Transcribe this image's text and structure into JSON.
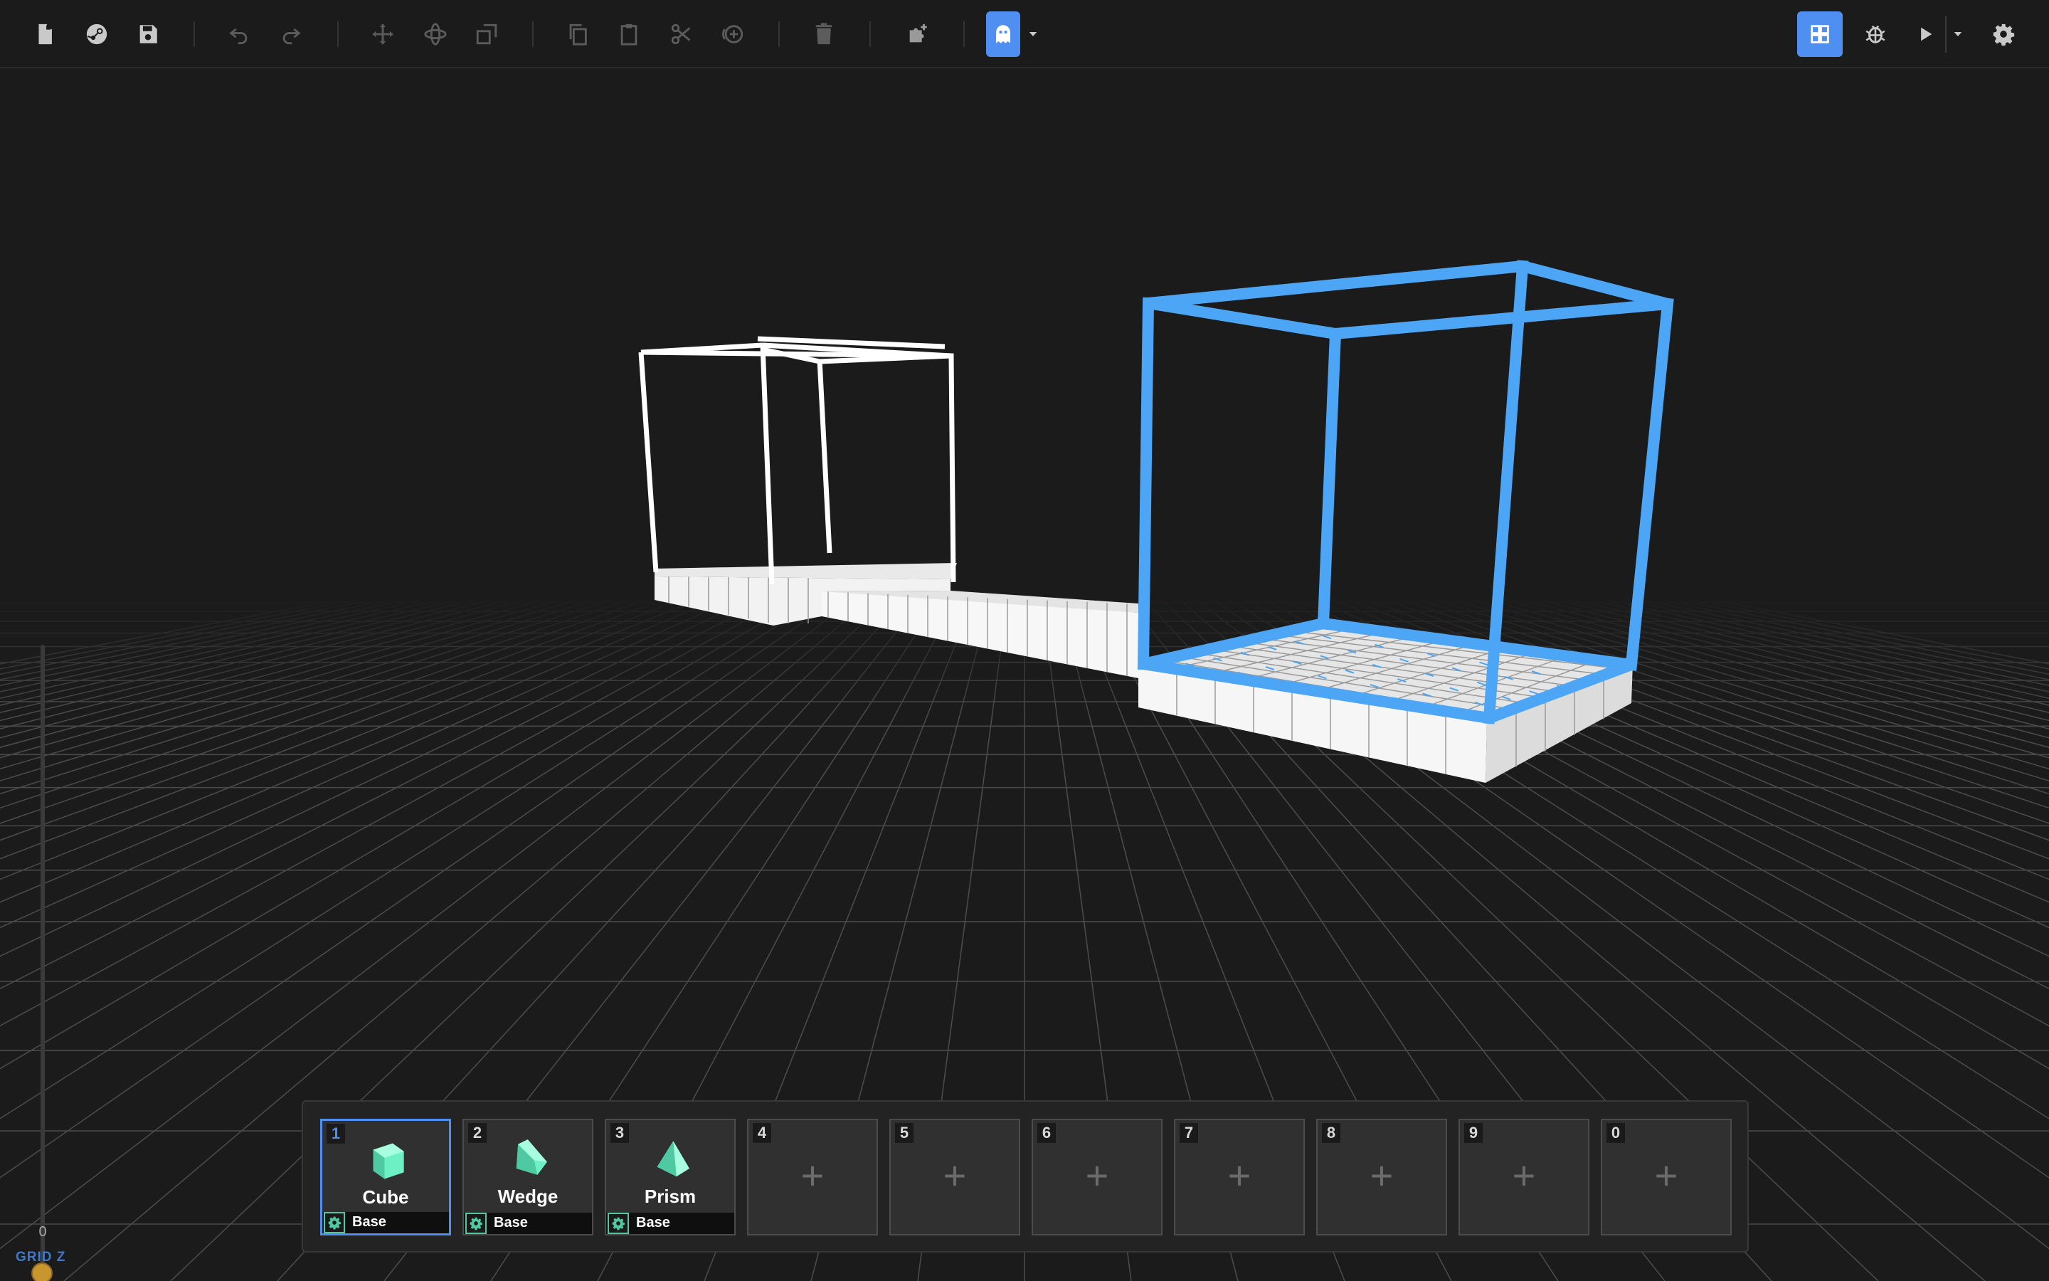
{
  "toolbar": {
    "left_groups": [
      [
        "new-file-icon",
        "steam-icon",
        "save-icon"
      ],
      [
        "undo-icon",
        "redo-icon"
      ],
      [
        "move-tool-icon",
        "rotate-tool-icon",
        "scale-tool-icon"
      ],
      [
        "copy-icon",
        "paste-icon",
        "cut-icon",
        "duplicate-icon"
      ],
      [
        "delete-icon"
      ],
      [
        "add-component-icon"
      ],
      [
        "ghost-mode-icon",
        "caret-down-icon"
      ]
    ],
    "right": [
      "grid-view-icon",
      "debug-icon",
      "play-icon",
      "caret-down-icon",
      "settings-icon"
    ],
    "accent": "#4f8ff2"
  },
  "grid_z": {
    "value": "0",
    "label": "GRID Z",
    "knob_color": "#c7962f"
  },
  "hotbar": {
    "slots": [
      {
        "key": "1",
        "name": "Cube",
        "category": "Base",
        "shape": "cube-icon",
        "selected": true
      },
      {
        "key": "2",
        "name": "Wedge",
        "category": "Base",
        "shape": "wedge-icon",
        "selected": false
      },
      {
        "key": "3",
        "name": "Prism",
        "category": "Base",
        "shape": "prism-icon",
        "selected": false
      },
      {
        "key": "4",
        "name": "",
        "category": "",
        "empty": true,
        "add_label": "+"
      },
      {
        "key": "5",
        "name": "",
        "category": "",
        "empty": true,
        "add_label": "+"
      },
      {
        "key": "6",
        "name": "",
        "category": "",
        "empty": true,
        "add_label": "+"
      },
      {
        "key": "7",
        "name": "",
        "category": "",
        "empty": true,
        "add_label": "+"
      },
      {
        "key": "8",
        "name": "",
        "category": "",
        "empty": true,
        "add_label": "+"
      },
      {
        "key": "9",
        "name": "",
        "category": "",
        "empty": true,
        "add_label": "+"
      },
      {
        "key": "0",
        "name": "",
        "category": "",
        "empty": true,
        "add_label": "+"
      }
    ],
    "icon_color": "#6ef0c5"
  },
  "scene": {
    "selection_color": "#4da6f5",
    "wire_color": "#ffffff",
    "grid_color": "#4a4a4a"
  }
}
